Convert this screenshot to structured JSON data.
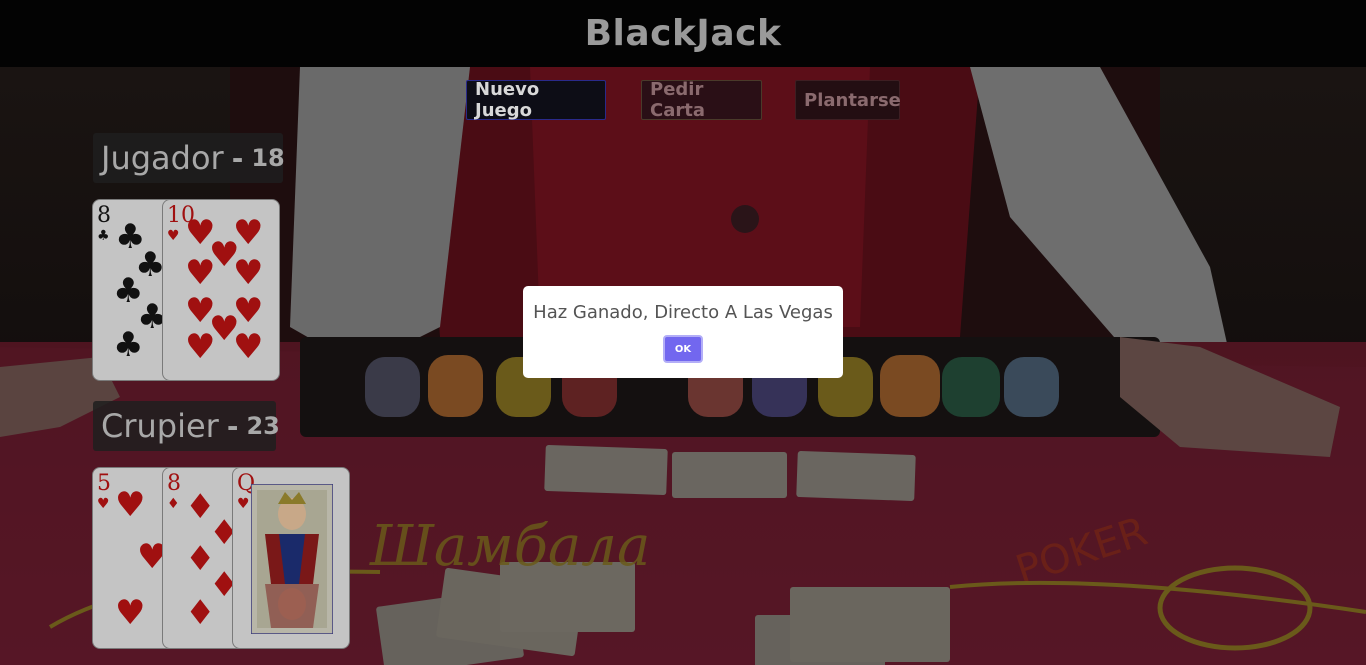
{
  "app": {
    "title": "BlackJack"
  },
  "controls": {
    "new_game": "Nuevo Juego",
    "hit": "Pedir Carta",
    "stand": "Plantarse"
  },
  "player": {
    "label": "Jugador",
    "separator": "-",
    "score": "18",
    "cards": [
      {
        "rank": "8",
        "suit": "clubs",
        "suit_symbol": "♣",
        "color": "black"
      },
      {
        "rank": "10",
        "suit": "hearts",
        "suit_symbol": "♥",
        "color": "red"
      }
    ]
  },
  "dealer": {
    "label": "Crupier",
    "separator": "-",
    "score": "23",
    "cards": [
      {
        "rank": "5",
        "suit": "hearts",
        "suit_symbol": "♥",
        "color": "red"
      },
      {
        "rank": "8",
        "suit": "diamonds",
        "suit_symbol": "♦",
        "color": "red"
      },
      {
        "rank": "Q",
        "suit": "hearts",
        "suit_symbol": "♥",
        "color": "red"
      }
    ]
  },
  "dialog": {
    "message": "Haz Ganado, Directo A Las Vegas",
    "ok_label": "OK"
  },
  "colors": {
    "header_bg": "#030303",
    "title_text": "#9a9a9a",
    "ok_button": "#7267ef",
    "table_felt": "#6a1626"
  }
}
